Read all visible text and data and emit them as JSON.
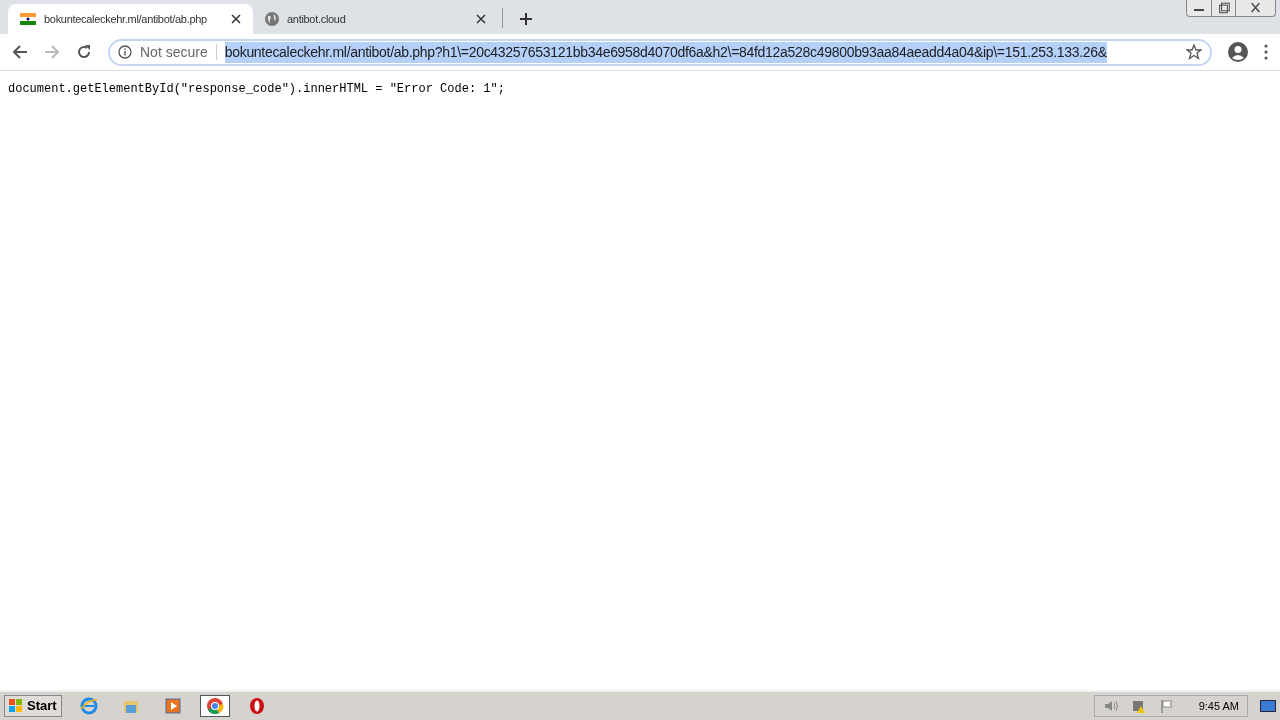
{
  "tabs": [
    {
      "title": "bokuntecaleckehr.ml/antibot/ab.php",
      "selected": true,
      "kind": "flag"
    },
    {
      "title": "antibot.cloud",
      "selected": false,
      "kind": "globe"
    }
  ],
  "address_bar": {
    "security": "Not secure",
    "url": "bokuntecaleckehr.ml/antibot/ab.php?h1\\=20c43257653121bb34e6958d4070df6a&h2\\=84fd12a528c49800b93aa84aeadd4a04&ip\\=151.253.133.26&",
    "selected": true
  },
  "page": {
    "code": "document.getElementById(\"response_code\").innerHTML = \"Error Code: 1\";"
  },
  "taskbar": {
    "start": "Start",
    "apps": [
      {
        "kind": "ie",
        "selected": false
      },
      {
        "kind": "folder",
        "selected": false
      },
      {
        "kind": "media",
        "selected": false
      },
      {
        "kind": "chrome",
        "selected": true
      },
      {
        "kind": "opera",
        "selected": false
      }
    ],
    "clock": "9:45 AM"
  }
}
